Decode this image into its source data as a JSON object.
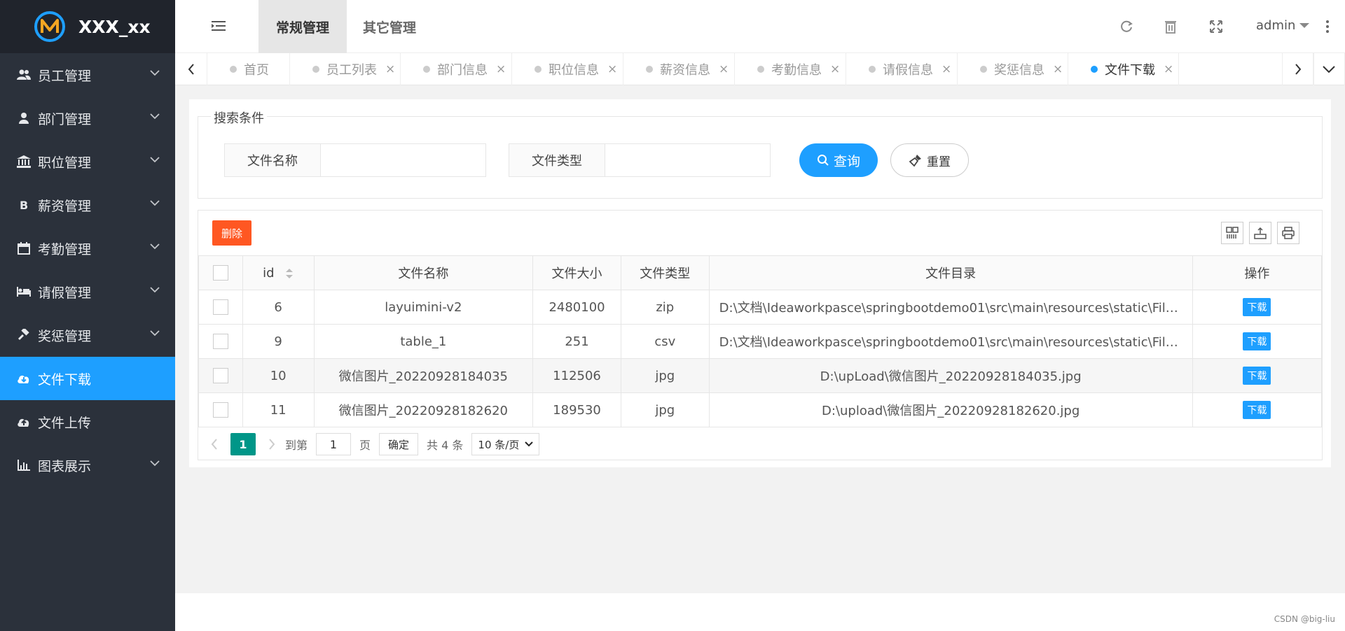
{
  "app": {
    "title": "XXX_xx"
  },
  "sidebar": {
    "items": [
      {
        "label": "员工管理",
        "icon": "users-icon",
        "expandable": true
      },
      {
        "label": "部门管理",
        "icon": "user-icon",
        "expandable": true
      },
      {
        "label": "职位管理",
        "icon": "bank-icon",
        "expandable": true
      },
      {
        "label": "薪资管理",
        "icon": "bitcoin-icon",
        "expandable": true
      },
      {
        "label": "考勤管理",
        "icon": "calendar-icon",
        "expandable": true
      },
      {
        "label": "请假管理",
        "icon": "bed-icon",
        "expandable": true
      },
      {
        "label": "奖惩管理",
        "icon": "gavel-icon",
        "expandable": true
      },
      {
        "label": "文件下载",
        "icon": "cloud-download-icon",
        "expandable": false,
        "active": true
      },
      {
        "label": "文件上传",
        "icon": "cloud-upload-icon",
        "expandable": false
      },
      {
        "label": "图表展示",
        "icon": "bar-chart-icon",
        "expandable": true
      }
    ]
  },
  "header": {
    "tabs": [
      "常规管理",
      "其它管理"
    ],
    "user": "admin"
  },
  "page_tabs": [
    {
      "label": "首页",
      "closable": false
    },
    {
      "label": "员工列表",
      "closable": true
    },
    {
      "label": "部门信息",
      "closable": true
    },
    {
      "label": "职位信息",
      "closable": true
    },
    {
      "label": "薪资信息",
      "closable": true
    },
    {
      "label": "考勤信息",
      "closable": true
    },
    {
      "label": "请假信息",
      "closable": true
    },
    {
      "label": "奖惩信息",
      "closable": true
    },
    {
      "label": "文件下载",
      "closable": true,
      "current": true
    }
  ],
  "search": {
    "legend": "搜索条件",
    "filename_label": "文件名称",
    "filename_value": "",
    "filetype_label": "文件类型",
    "filetype_value": "",
    "query_label": "查询",
    "reset_label": "重置"
  },
  "toolbar": {
    "delete_label": "删除"
  },
  "table": {
    "columns": [
      "id",
      "文件名称",
      "文件大小",
      "文件类型",
      "文件目录",
      "操作"
    ],
    "rows": [
      {
        "id": "6",
        "name": "layuimini-v2",
        "size": "2480100",
        "type": "zip",
        "dir": "D:\\文档\\Ideaworkpasce\\springbootdemo01\\src\\main\\resources\\static\\FileUpLoad\\l...",
        "action": "下载"
      },
      {
        "id": "9",
        "name": "table_1",
        "size": "251",
        "type": "csv",
        "dir": "D:\\文档\\Ideaworkpasce\\springbootdemo01\\src\\main\\resources\\static\\FileUpLoad\\t...",
        "action": "下载"
      },
      {
        "id": "10",
        "name": "微信图片_20220928184035",
        "size": "112506",
        "type": "jpg",
        "dir": "D:\\upLoad\\微信图片_20220928184035.jpg",
        "action": "下载"
      },
      {
        "id": "11",
        "name": "微信图片_20220928182620",
        "size": "189530",
        "type": "jpg",
        "dir": "D:\\upload\\微信图片_20220928182620.jpg",
        "action": "下载"
      }
    ]
  },
  "pager": {
    "current": "1",
    "goto_prefix": "到第",
    "goto_value": "1",
    "goto_suffix": "页",
    "confirm": "确定",
    "total": "共 4 条",
    "per_page": "10 条/页"
  },
  "footer": {
    "credit": "CSDN @big-liu"
  },
  "colors": {
    "sidebar_bg": "#2b313b",
    "accent": "#1e9fff",
    "delete": "#ff5722",
    "pager_current": "#009688"
  }
}
